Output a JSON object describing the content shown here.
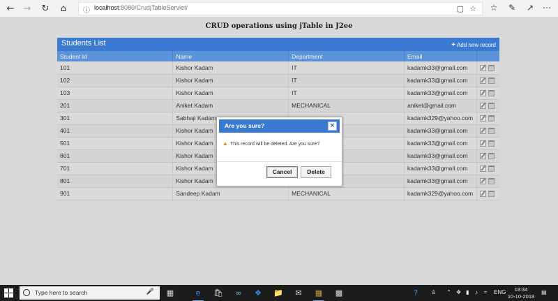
{
  "browser": {
    "url_host": "localhost",
    "url_rest": ":8080/CrudjTableServlet/"
  },
  "page": {
    "title": "CRUD operations using jTable in J2ee"
  },
  "table": {
    "title": "Students List",
    "add_label": "Add new record",
    "columns": [
      "Student Id",
      "Name",
      "Department",
      "Email"
    ],
    "rows": [
      [
        "101",
        "Kishor Kadam",
        "IT",
        "kadamk33@gmail.com"
      ],
      [
        "102",
        "Kishor Kadam",
        "IT",
        "kadamk33@gmail.com"
      ],
      [
        "103",
        "Kishor Kadam",
        "IT",
        "kadamk33@gmail.com"
      ],
      [
        "201",
        "Aniket Kadam",
        "MECHANICAL",
        "aniket@gmail.com"
      ],
      [
        "301",
        "Sabhaji Kadam",
        "",
        "kadamk329@yahoo.com"
      ],
      [
        "401",
        "Kishor Kadam",
        "",
        "kadamk33@gmail.com"
      ],
      [
        "501",
        "Kishor Kadam",
        "",
        "kadamk33@gmail.com"
      ],
      [
        "601",
        "Kishor Kadam",
        "",
        "kadamk33@gmail.com"
      ],
      [
        "701",
        "Kishor Kadam",
        "",
        "kadamk33@gmail.com"
      ],
      [
        "801",
        "Kishor Kadam",
        "",
        "kadamk33@gmail.com"
      ],
      [
        "901",
        "Sandeep Kadam",
        "MECHANICAL",
        "kadamk329@yahoo.com"
      ]
    ]
  },
  "dialog": {
    "title": "Are you sure?",
    "close_icon": "close-icon",
    "message": "This record will be deleted. Are you sure?",
    "cancel_label": "Cancel",
    "delete_label": "Delete"
  },
  "taskbar": {
    "search_placeholder": "Type here to search",
    "language": "ENG",
    "time": "18:34",
    "date": "10-10-2018"
  },
  "colors": {
    "accent": "#3a7bd1",
    "header_row": "#5b93d8"
  }
}
